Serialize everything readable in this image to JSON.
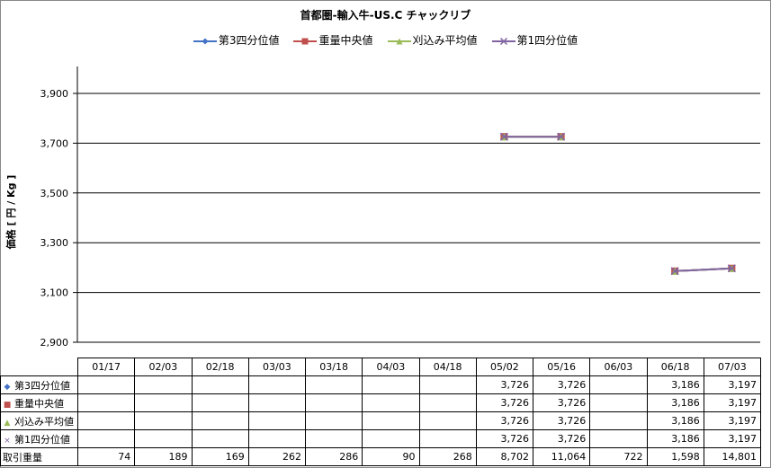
{
  "chart_data": {
    "type": "line",
    "title": "首都圏-輸入牛-US.C チャックリブ",
    "ylabel": "価格 [ 円 / Kg ]",
    "ylim": [
      2900,
      3900
    ],
    "yticks": [
      2900,
      3100,
      3300,
      3500,
      3700,
      3900
    ],
    "ytick_labels": [
      "2,900",
      "3,100",
      "3,300",
      "3,500",
      "3,700",
      "3,900"
    ],
    "categories": [
      "01/17",
      "02/03",
      "02/18",
      "03/03",
      "03/18",
      "04/03",
      "04/18",
      "05/02",
      "05/16",
      "06/03",
      "06/18",
      "07/03"
    ],
    "series": [
      {
        "name": "第3四分位値",
        "color": "#4472C4",
        "marker": "diamond",
        "values": [
          null,
          null,
          null,
          null,
          null,
          null,
          null,
          3726,
          3726,
          null,
          3186,
          3197
        ],
        "labels": [
          "",
          "",
          "",
          "",
          "",
          "",
          "",
          "3,726",
          "3,726",
          "",
          "3,186",
          "3,197"
        ]
      },
      {
        "name": "重量中央値",
        "color": "#C0504D",
        "marker": "square",
        "values": [
          null,
          null,
          null,
          null,
          null,
          null,
          null,
          3726,
          3726,
          null,
          3186,
          3197
        ],
        "labels": [
          "",
          "",
          "",
          "",
          "",
          "",
          "",
          "3,726",
          "3,726",
          "",
          "3,186",
          "3,197"
        ]
      },
      {
        "name": "刈込み平均値",
        "color": "#9BBB59",
        "marker": "triangle",
        "values": [
          null,
          null,
          null,
          null,
          null,
          null,
          null,
          3726,
          3726,
          null,
          3186,
          3197
        ],
        "labels": [
          "",
          "",
          "",
          "",
          "",
          "",
          "",
          "3,726",
          "3,726",
          "",
          "3,186",
          "3,197"
        ]
      },
      {
        "name": "第1四分位値",
        "color": "#8064A2",
        "marker": "x",
        "values": [
          null,
          null,
          null,
          null,
          null,
          null,
          null,
          3726,
          3726,
          null,
          3186,
          3197
        ],
        "labels": [
          "",
          "",
          "",
          "",
          "",
          "",
          "",
          "3,726",
          "3,726",
          "",
          "3,186",
          "3,197"
        ]
      }
    ],
    "volume": {
      "name": "取引重量",
      "labels": [
        "74",
        "189",
        "169",
        "262",
        "286",
        "90",
        "268",
        "8,702",
        "11,064",
        "722",
        "1,598",
        "14,801"
      ]
    },
    "grid": true,
    "legend": "top-center"
  }
}
